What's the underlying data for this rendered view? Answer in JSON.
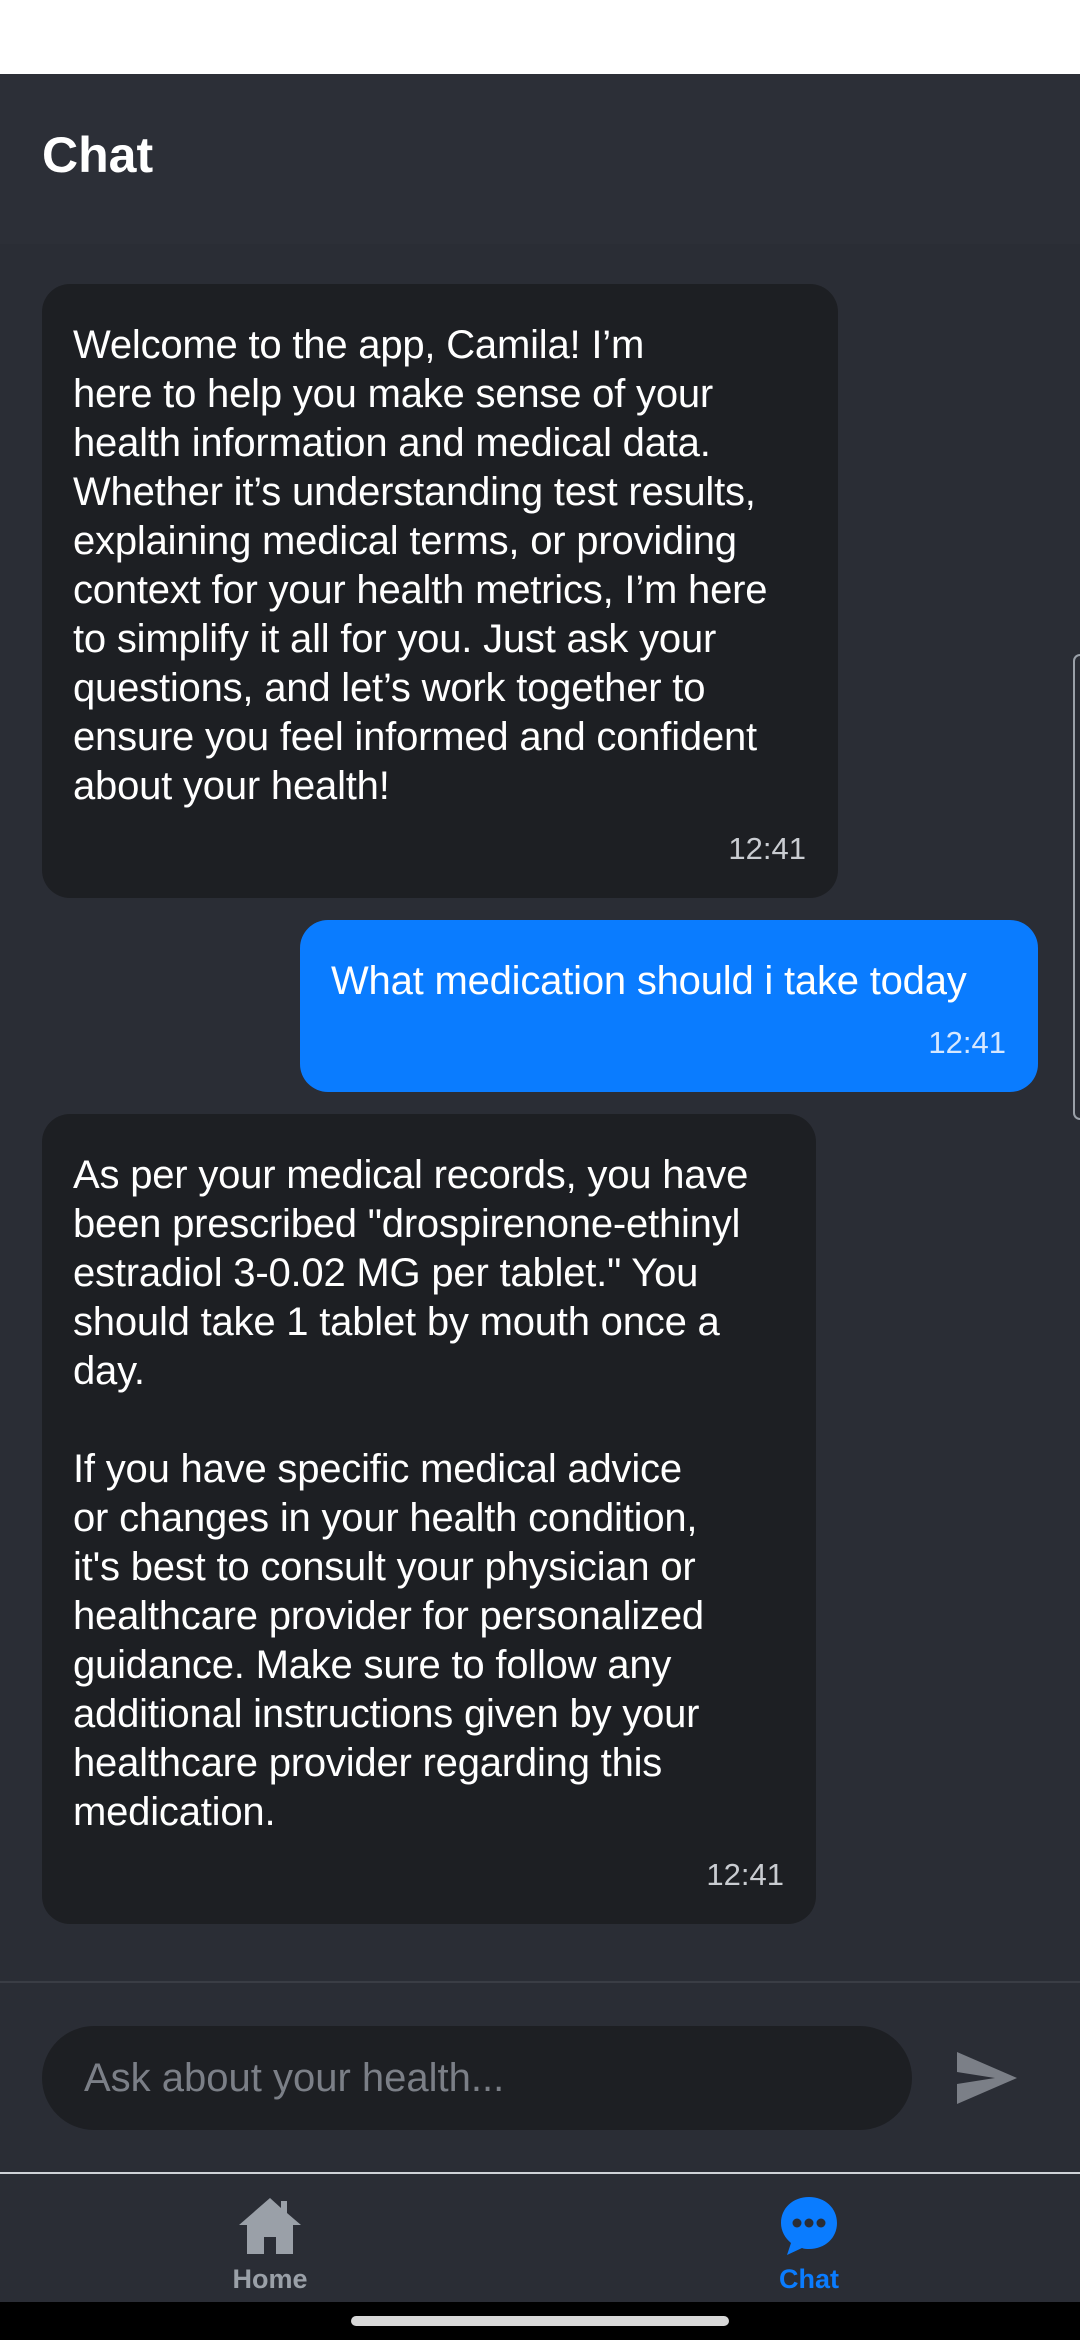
{
  "header": {
    "title": "Chat"
  },
  "messages": [
    {
      "sender": "bot",
      "text": "Welcome to the app, Camila! I’m\nhere to help you make sense of your\nhealth information and medical data.\nWhether it’s understanding test results,\nexplaining medical terms, or providing\ncontext for your health metrics, I’m here\nto simplify it all for you. Just ask your\nquestions, and let’s work together to\nensure you feel informed and confident\nabout your health!",
      "time": "12:41"
    },
    {
      "sender": "user",
      "text": "What medication should i take today",
      "time": "12:41"
    },
    {
      "sender": "bot",
      "text": "As per your medical records, you have\nbeen prescribed \"drospirenone-ethinyl\nestradiol 3-0.02 MG per tablet.\" You\nshould take 1 tablet by mouth once a\nday.\n\nIf you have specific medical advice\nor changes in your health condition,\nit's best to consult your physician or\nhealthcare provider for personalized\nguidance. Make sure to follow any\nadditional instructions given by your\nhealthcare provider regarding this\nmedication.",
      "time": "12:41"
    }
  ],
  "input": {
    "placeholder": "Ask about your health...",
    "value": ""
  },
  "nav": {
    "items": [
      {
        "label": "Home",
        "icon": "home-icon",
        "active": false
      },
      {
        "label": "Chat",
        "icon": "chat-bubble-icon",
        "active": true
      }
    ]
  },
  "colors": {
    "accent": "#0a7cff",
    "background": "#2a2d35",
    "bot_bubble": "#1d1f23",
    "inactive_nav": "#9aa0a8"
  }
}
